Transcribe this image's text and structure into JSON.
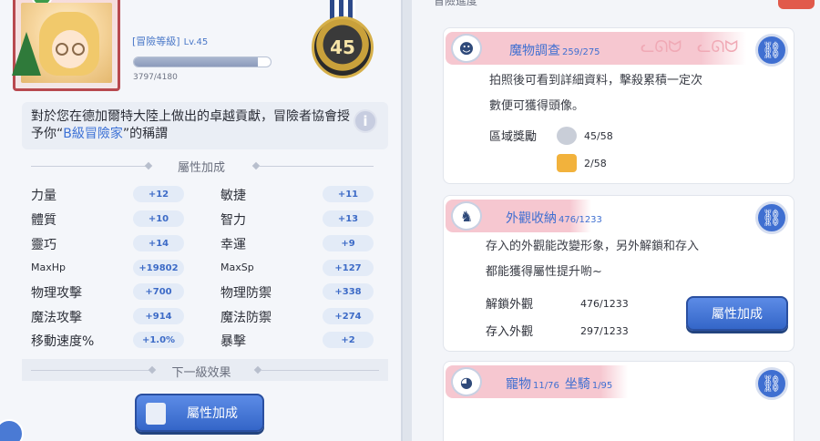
{
  "profile": {
    "adv_level_label": "[冒險等級]",
    "adv_level_value": "Lv.45",
    "xp_text": "3797/4180",
    "xp_fraction": 0.908,
    "medal_number": "45"
  },
  "description": {
    "prefix": "對於您在德加爾特大陸上做出的卓越貢獻，冒險者協會授予你“",
    "highlight": "B級冒險家",
    "suffix": "”的稱謂"
  },
  "sections": {
    "attr_bonus_title": "屬性加成",
    "next_level_title": "下一級效果"
  },
  "stats": [
    {
      "left_label": "力量",
      "left_value": "+12",
      "right_label": "敏捷",
      "right_value": "+11"
    },
    {
      "left_label": "體質",
      "left_value": "+10",
      "right_label": "智力",
      "right_value": "+13"
    },
    {
      "left_label": "靈巧",
      "left_value": "+14",
      "right_label": "幸運",
      "right_value": "+9"
    },
    {
      "left_label": "MaxHp",
      "left_value": "+19802",
      "right_label": "MaxSp",
      "right_value": "+127"
    },
    {
      "left_label": "物理攻擊",
      "left_value": "+700",
      "right_label": "物理防禦",
      "right_value": "+338"
    },
    {
      "left_label": "魔法攻擊",
      "left_value": "+914",
      "right_label": "魔法防禦",
      "right_value": "+274"
    },
    {
      "left_label": "移動速度%",
      "left_value": "+1.0%",
      "right_label": "暴擊",
      "right_value": "+2"
    }
  ],
  "left_button": "屬性加成",
  "right_panel": {
    "title": "冒險進度",
    "monster": {
      "title": "魔物調查",
      "count": "259/275",
      "body_line1": "拍照後可看到詳細資料，擊殺累積一定次",
      "body_line2": "數便可獲得頭像。",
      "reward_label": "區域獎勵",
      "reward_silver": "45/58",
      "reward_gold": "2/58"
    },
    "appearance": {
      "title": "外觀收納",
      "count": "476/1233",
      "body_line1": "存入的外觀能改變形象，另外解鎖和存入",
      "body_line2": "都能獲得屬性提升喲~",
      "unlock_label": "解鎖外觀",
      "unlock_value": "476/1233",
      "stored_label": "存入外觀",
      "stored_value": "297/1233",
      "button": "屬性加成"
    },
    "pets": {
      "title_pet": "寵物",
      "count_pet": "11/76",
      "title_mount": "坐騎",
      "count_mount": "1/95"
    }
  },
  "colors": {
    "accent_blue": "#3f6fd1",
    "card_header_pink": "#f6c7d0",
    "stat_value_blue": "#3d6bc7"
  },
  "icons": [
    "info-icon",
    "link-icon",
    "book-icon",
    "share-icon",
    "cat-icon",
    "medal-icon"
  ]
}
